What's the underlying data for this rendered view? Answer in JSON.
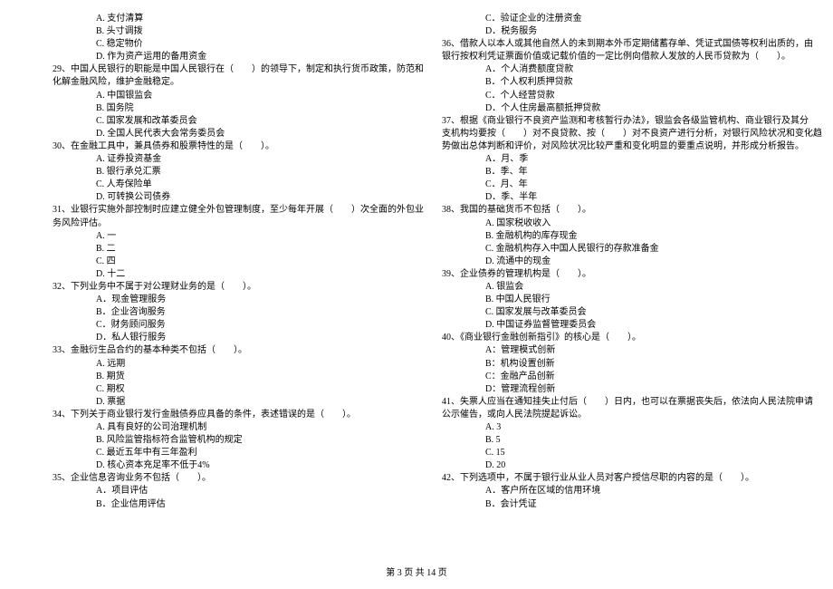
{
  "left": {
    "q28opts": [
      "A. 支付清算",
      "B. 头寸调拨",
      "C. 稳定物价",
      "D. 作为资产运用的备用资金"
    ],
    "q29": "29、中国人民银行的职能是中国人民银行在（　　）的领导下，制定和执行货币政策，防范和",
    "q29b": "化解金融风险，维护金融稳定。",
    "q29opts": [
      "A. 中国银监会",
      "B. 国务院",
      "C. 国家发展和改革委员会",
      "D. 全国人民代表大会常务委员会"
    ],
    "q30": "30、在金融工具中，兼具债券和股票特性的是（　　）。",
    "q30opts": [
      "A. 证券投资基金",
      "B. 银行承兑汇票",
      "C. 人寿保险单",
      "D. 可转换公司债券"
    ],
    "q31": "31、业银行实施外部控制时应建立健全外包管理制度，至少每年开展（　　）次全面的外包业",
    "q31b": "务风险评估。",
    "q31opts": [
      "A. 一",
      "B. 二",
      "C. 四",
      "D. 十二"
    ],
    "q32": "32、下列业务中不属于对公理财业务的是（　　）。",
    "q32opts": [
      "A．现金管理服务",
      "B．企业咨询服务",
      "C．财务顾问服务",
      "D．私人银行服务"
    ],
    "q33": "33、金融衍生品合约的基本种类不包括（　　）。",
    "q33opts": [
      "A. 远期",
      "B. 期货",
      "C. 期权",
      "D. 票据"
    ],
    "q34": "34、下列关于商业银行发行金融债券应具备的条件，表述错误的是（　　）。",
    "q34opts": [
      "A. 具有良好的公司治理机制",
      "B. 风险监管指标符合监管机构的规定",
      "C. 最近五年中有三年盈利",
      "D. 核心资本充足率不低于4%"
    ],
    "q35": "35、企业信息咨询业务不包括（　　）。",
    "q35opts": [
      "A．项目评估",
      "B．企业信用评估"
    ]
  },
  "right": {
    "q35opts": [
      "C．验证企业的注册资金",
      "D．税务服务"
    ],
    "q36": "36、借款人以本人或其他自然人的未到期本外币定期储蓄存单、凭证式国债等权利出质的，由",
    "q36b": "银行按权利凭证票面价值或记载价值的一定比例向借款人发放的人民币贷款为（　　）。",
    "q36opts": [
      "A．个人消费额度贷款",
      "B．个人权利质押贷款",
      "C．个人经营贷款",
      "D．个人住房最高额抵押贷款"
    ],
    "q37": "37、根据《商业银行不良资产监测和考核暂行办法》，银监会各级监管机构、商业银行及其分",
    "q37b": "支机构均要按（　　）对不良贷款、按（　　）对不良资产进行分析，对银行风险状况和变化趋",
    "q37c": "势做出总体判断和评价，对风险状况比较严重和变化明显的要重点说明，并形成分析报告。",
    "q37opts": [
      "A．月、季",
      "B．季、年",
      "C．月、年",
      "D．季、半年"
    ],
    "q38": "38、我国的基础货币不包括（　　）。",
    "q38opts": [
      "A. 国家税收收入",
      "B. 金融机构的库存现金",
      "C. 金融机构存入中国人民银行的存款准备金",
      "D. 流通中的现金"
    ],
    "q39": "39、企业债券的管理机构是（　　）。",
    "q39opts": [
      "A. 银监会",
      "B. 中国人民银行",
      "C. 国家发展与改革委员会",
      "D. 中国证券监督管理委员会"
    ],
    "q40": "40、《商业银行金融创新指引》的核心是（　　）。",
    "q40opts": [
      "A：管理模式创新",
      "B：机构设置创新",
      "C：金融产品创新",
      "D：管理流程创新"
    ],
    "q41": "41、失票人应当在通知挂失止付后（　　）日内，也可以在票据丧失后，依法向人民法院申请",
    "q41b": "公示催告，或向人民法院提起诉讼。",
    "q41opts": [
      "A. 3",
      "B. 5",
      "C. 15",
      "D. 20"
    ],
    "q42": "42、下列选项中，不属于银行业从业人员对客户授信尽职的内容的是（　　）。",
    "q42opts": [
      "A．客户所在区域的信用环境",
      "B．会计凭证"
    ]
  },
  "footer": "第 3 页 共 14 页"
}
